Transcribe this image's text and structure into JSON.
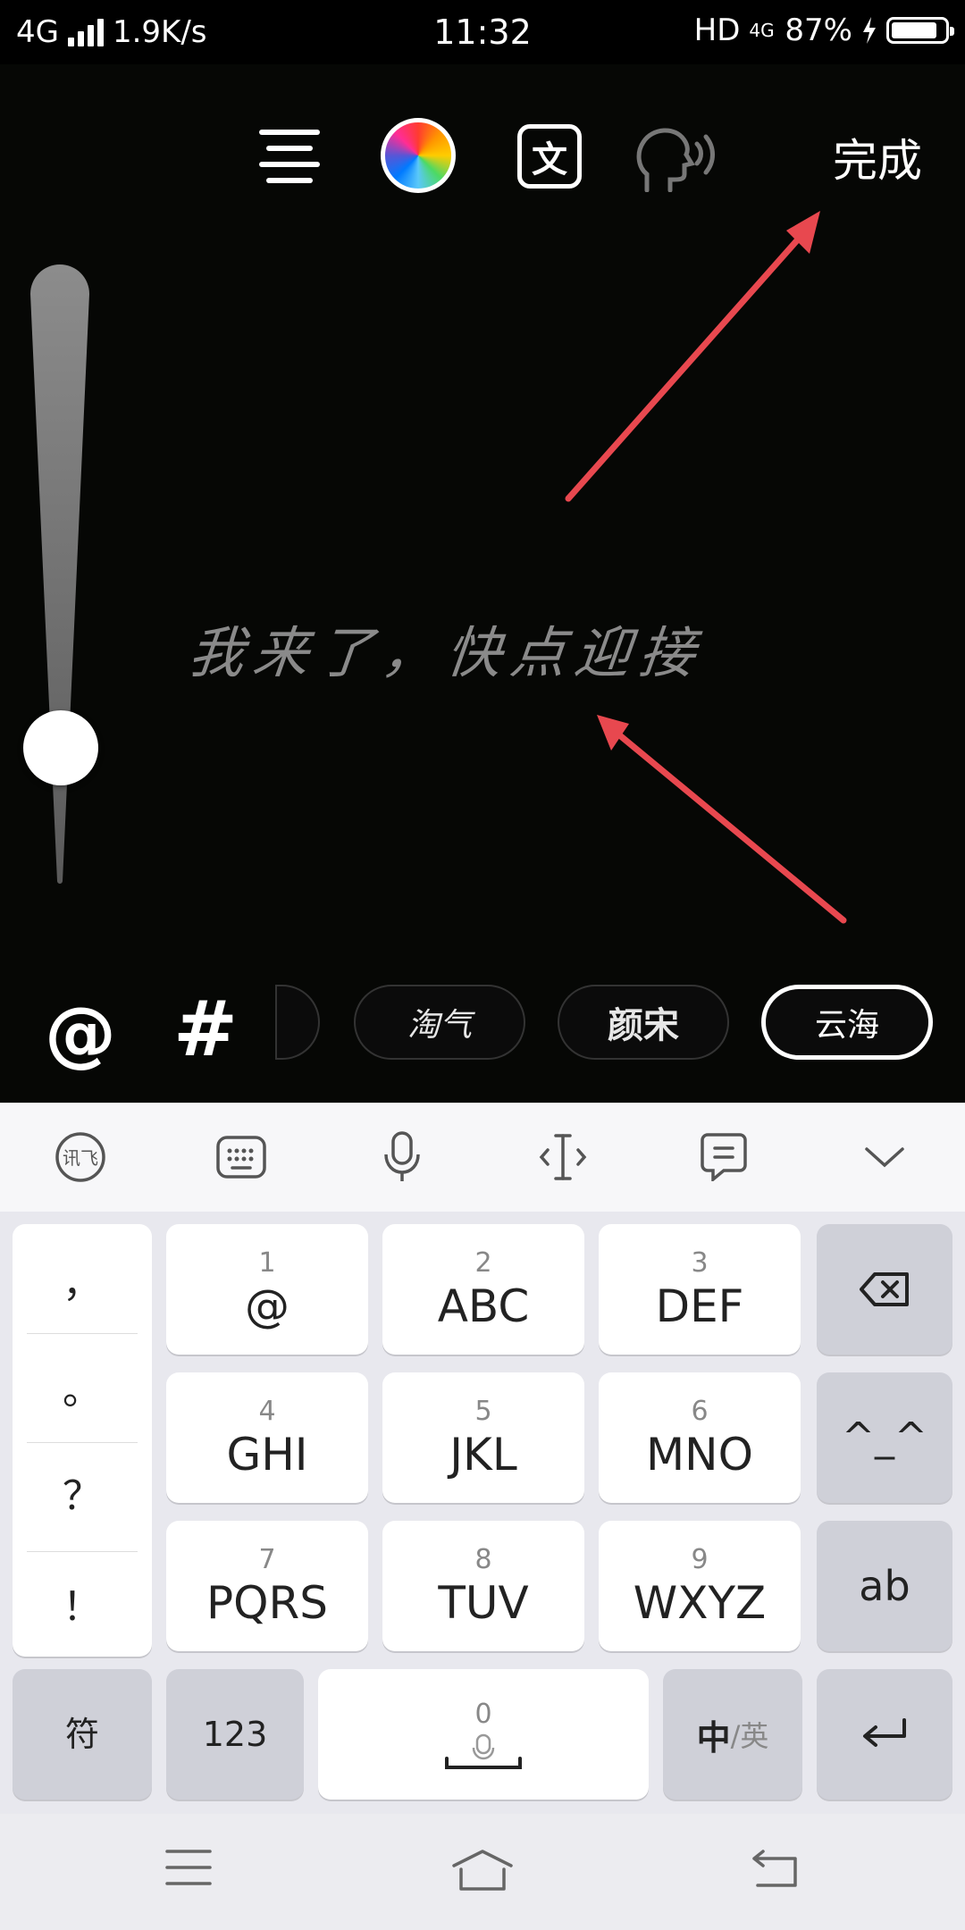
{
  "status_bar": {
    "network": "4G",
    "speed": "1.9K/s",
    "time": "11:32",
    "hd": "HD",
    "net_small": "4G",
    "battery": "87%",
    "battery_level": 0.87
  },
  "editor": {
    "done_label": "完成",
    "text": "我来了，快点迎接",
    "brush_size_level": 0.22,
    "icons": [
      "align-icon",
      "color-wheel-icon",
      "font-icon",
      "voice-icon"
    ]
  },
  "tags": {
    "mention": "@",
    "hashtag": "#"
  },
  "fonts": [
    {
      "label": "淘气",
      "selected": false
    },
    {
      "label": "颜宋",
      "selected": false
    },
    {
      "label": "云海",
      "selected": true
    }
  ],
  "keyboard": {
    "punct": [
      "，",
      "。",
      "？",
      "！"
    ],
    "keys": [
      {
        "num": "1",
        "let": "@"
      },
      {
        "num": "2",
        "let": "ABC"
      },
      {
        "num": "3",
        "let": "DEF"
      },
      {
        "num": "4",
        "let": "GHI"
      },
      {
        "num": "5",
        "let": "JKL"
      },
      {
        "num": "6",
        "let": "MNO"
      },
      {
        "num": "7",
        "let": "PQRS"
      },
      {
        "num": "8",
        "let": "TUV"
      },
      {
        "num": "9",
        "let": "WXYZ"
      }
    ],
    "emoticon": "^_^",
    "ab": "ab",
    "symbol": "符",
    "numeric": "123",
    "space_num": "0",
    "lang_main": "中",
    "lang_alt": "/英"
  }
}
